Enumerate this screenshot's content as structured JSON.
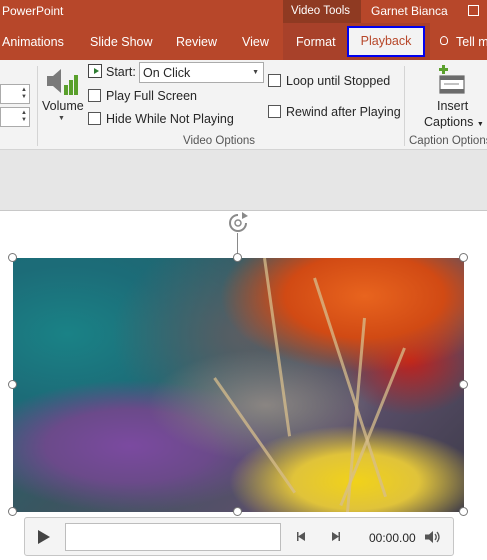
{
  "app_title": "PowerPoint",
  "context_group": "Video Tools",
  "user_name": "Garnet Bianca",
  "tabs": {
    "animations": "Animations",
    "slide_show": "Slide Show",
    "review": "Review",
    "view": "View",
    "format": "Format",
    "playback": "Playback",
    "tell_me": "Tell m"
  },
  "ribbon": {
    "volume_label": "Volume",
    "start_label": "Start:",
    "start_value": "On Click",
    "play_full_screen": "Play Full Screen",
    "hide_while_not_playing": "Hide While Not Playing",
    "loop_until_stopped": "Loop until Stopped",
    "rewind_after_playing": "Rewind after Playing",
    "video_options_group": "Video Options",
    "insert_captions_line1": "Insert",
    "insert_captions_line2": "Captions",
    "caption_options_group": "Caption Options"
  },
  "player": {
    "time": "00:00.00"
  },
  "colors": {
    "accent": "#b7472a",
    "accent_dark": "#8f3a22",
    "highlight_border": "#0000ee"
  }
}
